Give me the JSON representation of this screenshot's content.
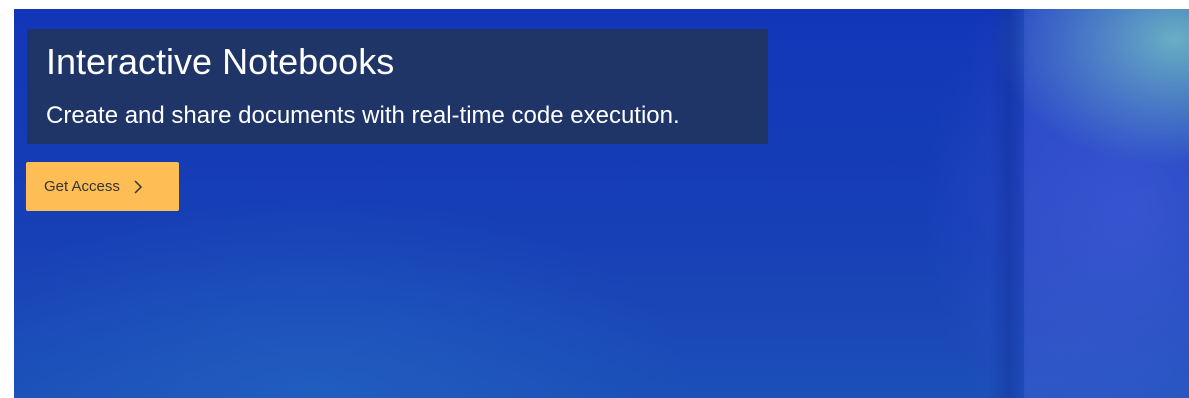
{
  "hero": {
    "title": "Interactive Notebooks",
    "subtitle": "Create and share documents with real-time code execution.",
    "cta_label": "Get Access",
    "cta_icon": "chevron-right-icon"
  },
  "colors": {
    "hero_background": "#1740b6",
    "caption_background": "#213460",
    "cta_background": "#ffbe55",
    "cta_text": "#333333",
    "title_text": "#ffffff"
  }
}
